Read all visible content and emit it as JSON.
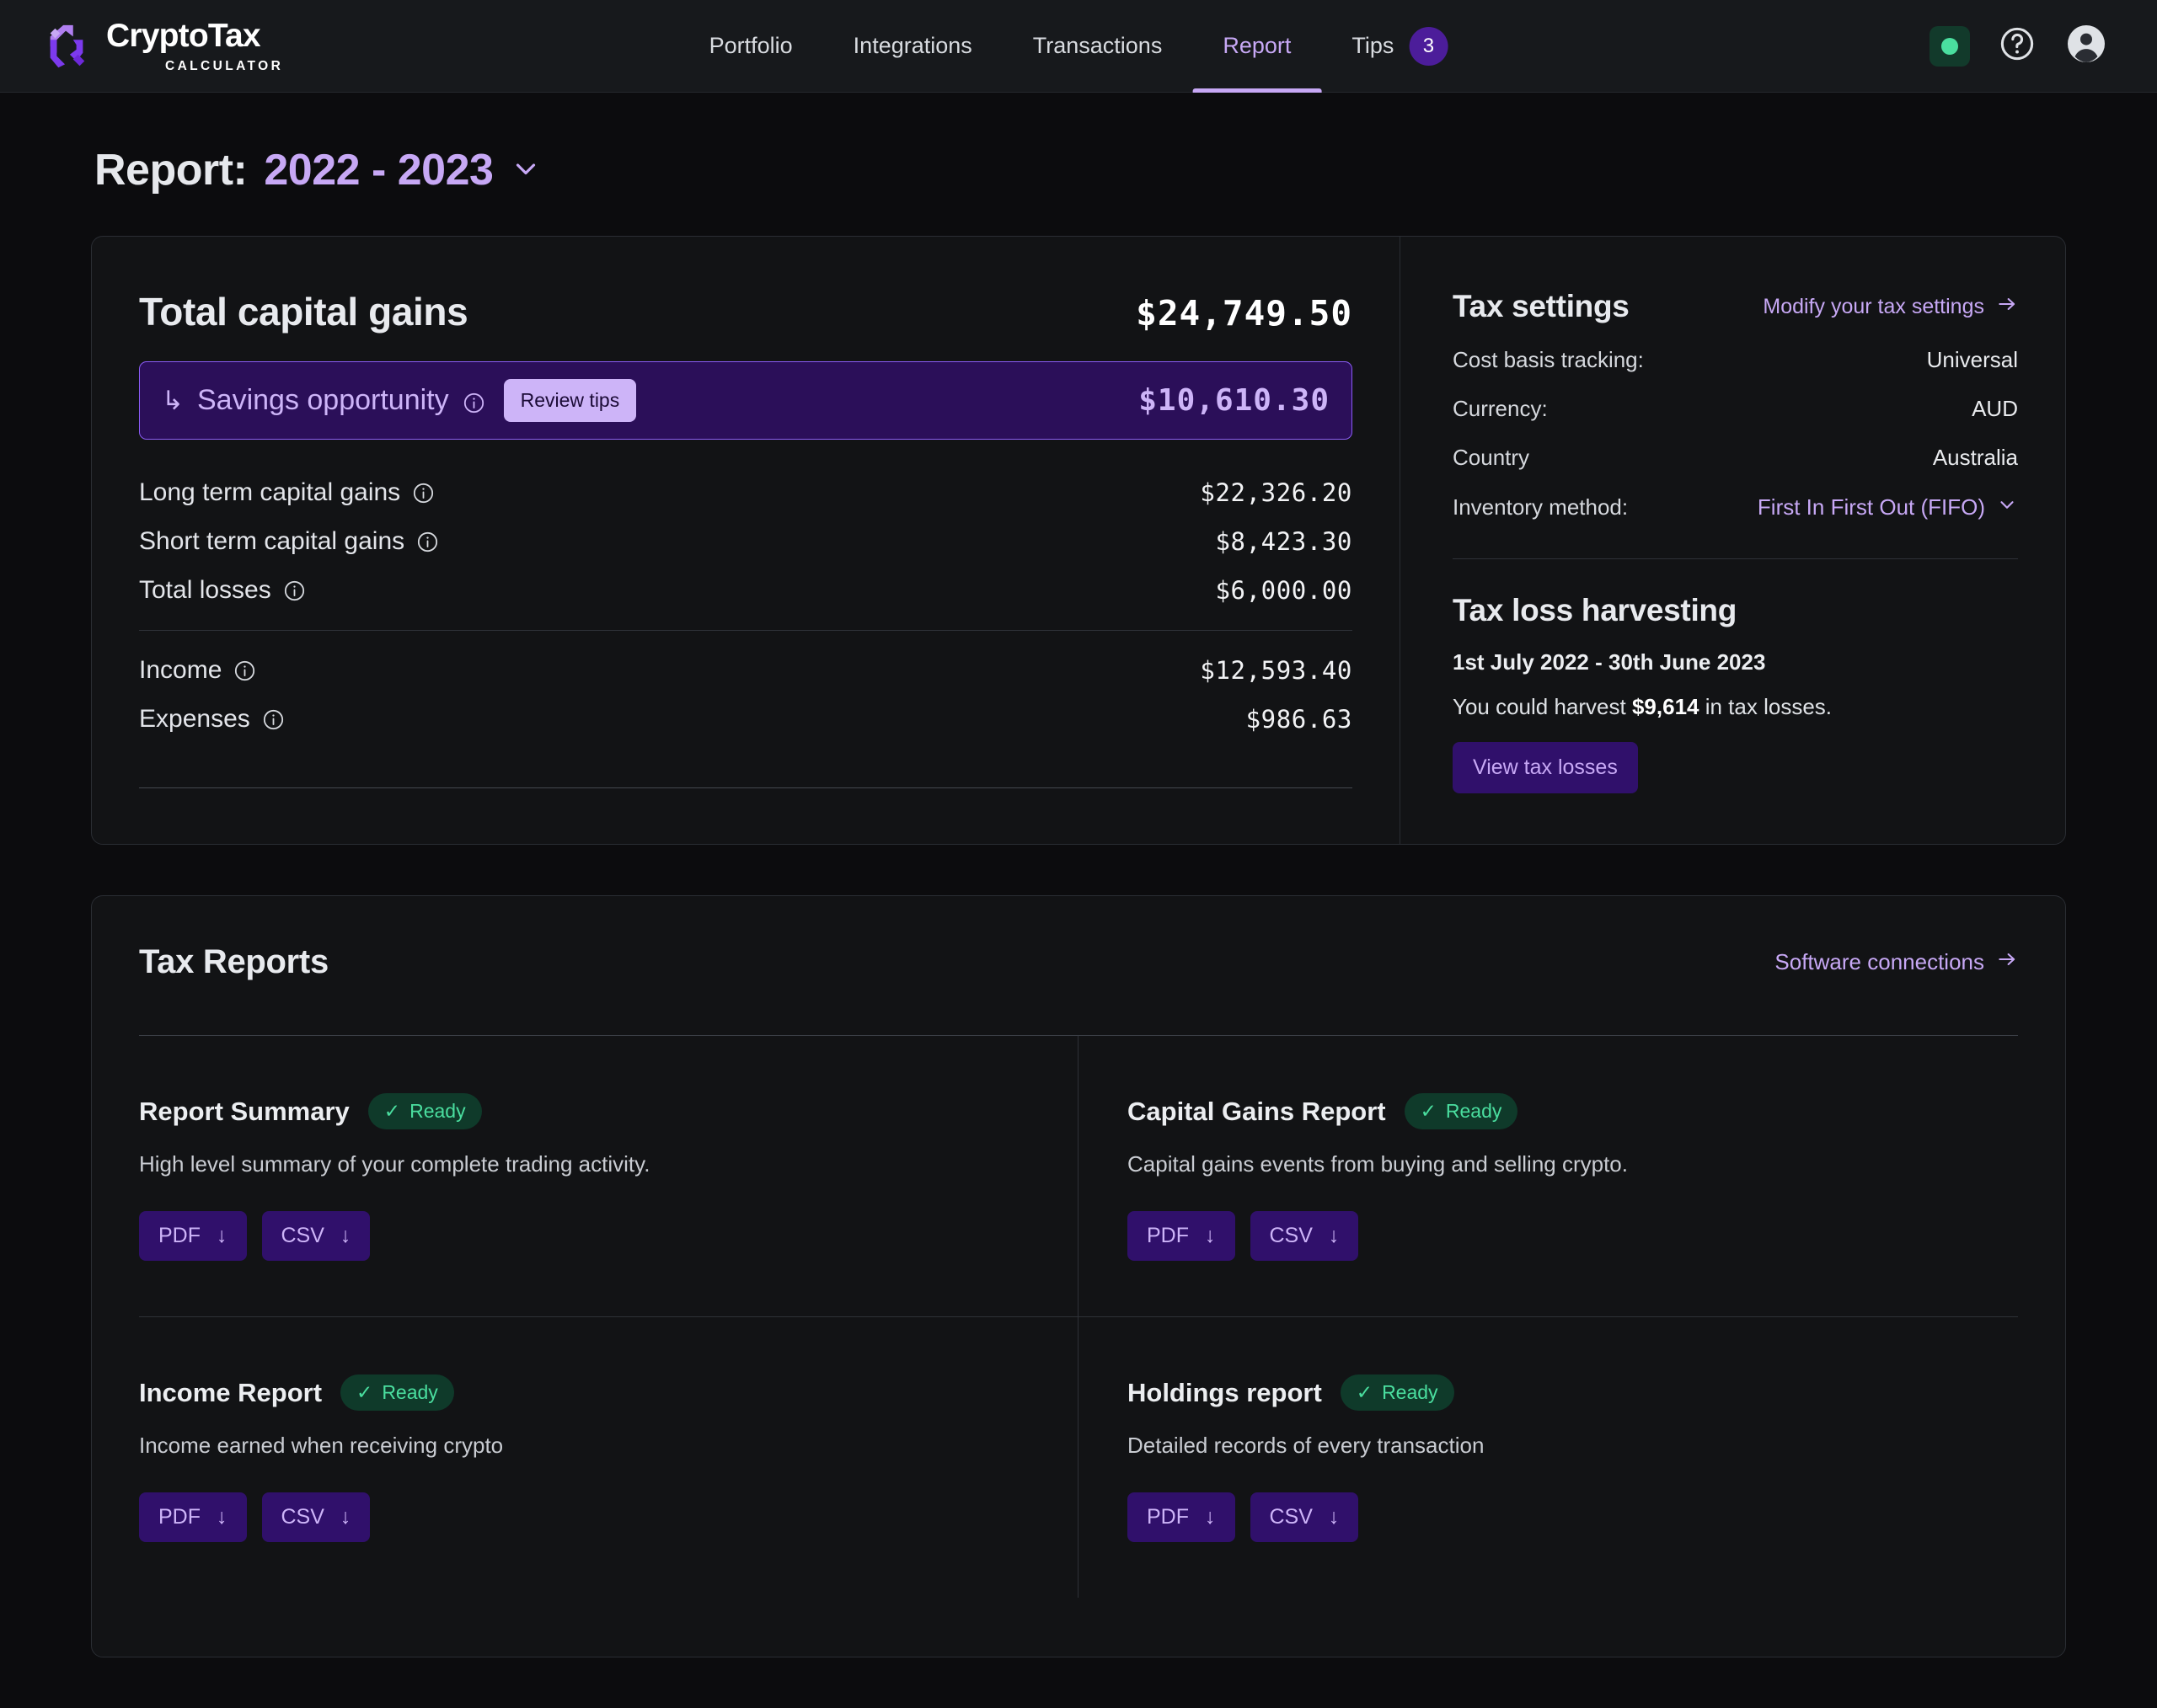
{
  "brand": {
    "name": "CryptoTax",
    "sub": "CALCULATOR"
  },
  "nav": {
    "items": [
      {
        "label": "Portfolio",
        "active": false
      },
      {
        "label": "Integrations",
        "active": false
      },
      {
        "label": "Transactions",
        "active": false
      },
      {
        "label": "Report",
        "active": true
      },
      {
        "label": "Tips",
        "active": false,
        "badge": "3"
      }
    ]
  },
  "header_title": {
    "label": "Report:",
    "year": "2022 - 2023"
  },
  "summary": {
    "total_label": "Total capital gains",
    "total_value": "$24,749.50",
    "savings": {
      "label": "Savings opportunity",
      "button": "Review tips",
      "value": "$10,610.30"
    },
    "lines": [
      {
        "label": "Long term capital gains",
        "value": "$22,326.20"
      },
      {
        "label": "Short term capital gains",
        "value": "$8,423.30"
      },
      {
        "label": "Total losses",
        "value": "$6,000.00"
      }
    ],
    "lines2": [
      {
        "label": "Income",
        "value": "$12,593.40"
      },
      {
        "label": "Expenses",
        "value": "$986.63"
      }
    ]
  },
  "tax_settings": {
    "title": "Tax settings",
    "modify_link": "Modify your tax settings",
    "rows": [
      {
        "key": "Cost basis tracking:",
        "value": "Universal",
        "is_link": false
      },
      {
        "key": "Currency:",
        "value": "AUD",
        "is_link": false
      },
      {
        "key": "Country",
        "value": "Australia",
        "is_link": false
      },
      {
        "key": "Inventory method:",
        "value": "First In First Out (FIFO)",
        "is_link": true
      }
    ]
  },
  "tax_loss_harvesting": {
    "title": "Tax loss harvesting",
    "dates": "1st July 2022 - 30th June 2023",
    "text_before": "You could harvest ",
    "amount": "$9,614",
    "text_after": " in tax losses.",
    "button": "View tax losses"
  },
  "tax_reports": {
    "title": "Tax Reports",
    "software_link": "Software connections",
    "ready_label": "Ready",
    "pdf_label": "PDF",
    "csv_label": "CSV",
    "items": [
      {
        "name": "Report Summary",
        "status": "Ready",
        "desc": "High level summary of your complete trading activity."
      },
      {
        "name": "Capital Gains Report",
        "status": "Ready",
        "desc": "Capital gains events from buying and selling crypto."
      },
      {
        "name": "Income Report",
        "status": "Ready",
        "desc": "Income earned when receiving crypto"
      },
      {
        "name": "Holdings report",
        "status": "Ready",
        "desc": "Detailed records of every transaction"
      }
    ]
  },
  "colors": {
    "accent": "#c7a8f5",
    "accent_deep": "#30106b",
    "page_bg": "#0c0c0e",
    "card_bg": "#121315",
    "ready_green": "#4ade9f",
    "badge_purple": "#4c1d9a"
  }
}
